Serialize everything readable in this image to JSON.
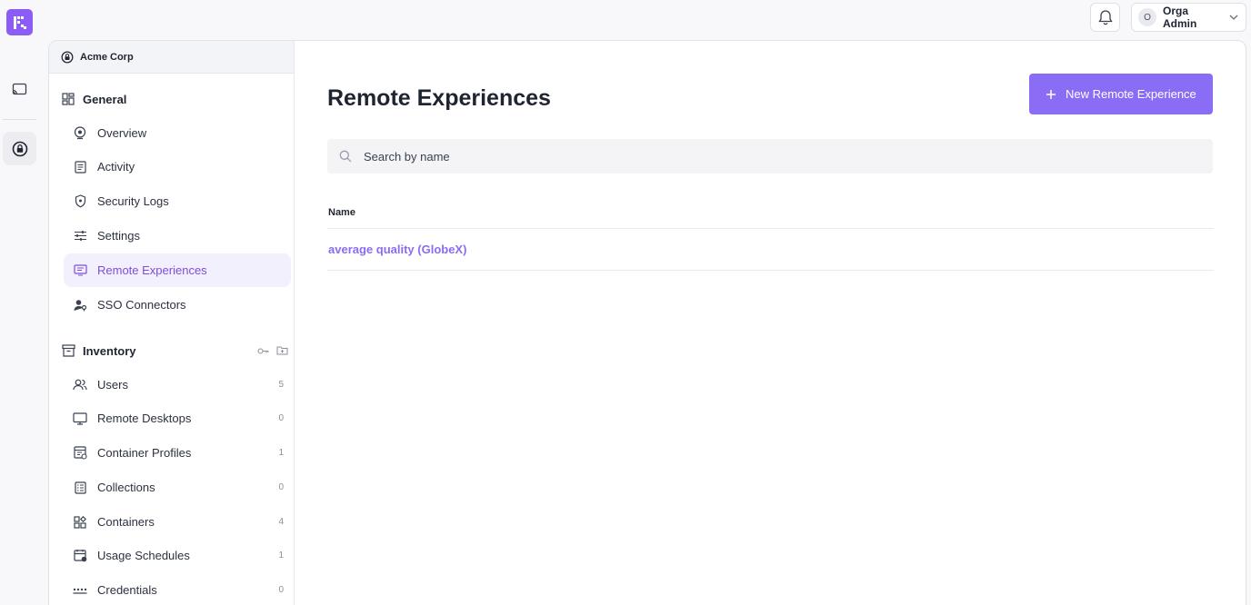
{
  "header": {
    "user": {
      "initial": "O",
      "name": "Orga Admin"
    }
  },
  "org": {
    "name": "Acme Corp"
  },
  "sidebar": {
    "general": {
      "title": "General",
      "items": [
        {
          "label": "Overview",
          "icon": "overview-icon"
        },
        {
          "label": "Activity",
          "icon": "activity-icon"
        },
        {
          "label": "Security Logs",
          "icon": "shield-icon"
        },
        {
          "label": "Settings",
          "icon": "settings-icon"
        },
        {
          "label": "Remote Experiences",
          "icon": "remote-experience-icon",
          "active": true
        },
        {
          "label": "SSO Connectors",
          "icon": "sso-icon"
        }
      ]
    },
    "inventory": {
      "title": "Inventory",
      "items": [
        {
          "label": "Users",
          "count": "5"
        },
        {
          "label": "Remote Desktops",
          "count": "0"
        },
        {
          "label": "Container Profiles",
          "count": "1"
        },
        {
          "label": "Collections",
          "count": "0"
        },
        {
          "label": "Containers",
          "count": "4"
        },
        {
          "label": "Usage Schedules",
          "count": "1"
        },
        {
          "label": "Credentials",
          "count": "0"
        }
      ]
    }
  },
  "main": {
    "title": "Remote Experiences",
    "new_button": "New Remote Experience",
    "search_placeholder": "Search by name",
    "table": {
      "columns": [
        "Name"
      ],
      "rows": [
        {
          "name": "average quality (GlobeX)"
        }
      ]
    }
  },
  "colors": {
    "accent": "#8b6cf4",
    "active_bg": "#f3f0fe"
  }
}
